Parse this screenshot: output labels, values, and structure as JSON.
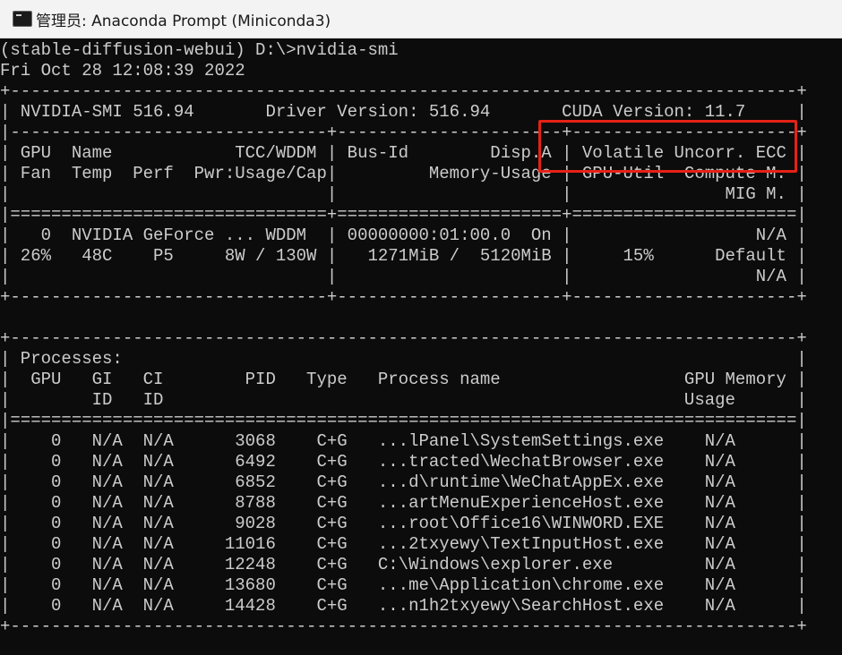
{
  "window": {
    "title": "管理员: Anaconda Prompt (Miniconda3)",
    "icon": "terminal-icon"
  },
  "terminal": {
    "lines": [
      "(stable-diffusion-webui) D:\\>nvidia-smi",
      "Fri Oct 28 12:08:39 2022",
      "+-----------------------------------------------------------------------------+",
      "| NVIDIA-SMI 516.94       Driver Version: 516.94       CUDA Version: 11.7     |",
      "|-------------------------------+----------------------+----------------------+",
      "| GPU  Name            TCC/WDDM | Bus-Id        Disp.A | Volatile Uncorr. ECC |",
      "| Fan  Temp  Perf  Pwr:Usage/Cap|         Memory-Usage | GPU-Util  Compute M. |",
      "|                               |                      |               MIG M. |",
      "|===============================+======================+======================|",
      "|   0  NVIDIA GeForce ... WDDM  | 00000000:01:00.0  On |                  N/A |",
      "| 26%   48C    P5     8W / 130W |   1271MiB /  5120MiB |     15%      Default |",
      "|                               |                      |                  N/A |",
      "+-------------------------------+----------------------+----------------------+",
      "",
      "+-----------------------------------------------------------------------------+",
      "| Processes:                                                                  |",
      "|  GPU   GI   CI        PID   Type   Process name                  GPU Memory |",
      "|        ID   ID                                                   Usage      |",
      "|=============================================================================|",
      "|    0   N/A  N/A      3068    C+G   ...lPanel\\SystemSettings.exe    N/A      |",
      "|    0   N/A  N/A      6492    C+G   ...tracted\\WechatBrowser.exe    N/A      |",
      "|    0   N/A  N/A      6852    C+G   ...d\\runtime\\WeChatAppEx.exe    N/A      |",
      "|    0   N/A  N/A      8788    C+G   ...artMenuExperienceHost.exe    N/A      |",
      "|    0   N/A  N/A      9028    C+G   ...root\\Office16\\WINWORD.EXE    N/A      |",
      "|    0   N/A  N/A     11016    C+G   ...2txyewy\\TextInputHost.exe    N/A      |",
      "|    0   N/A  N/A     12248    C+G   C:\\Windows\\explorer.exe         N/A      |",
      "|    0   N/A  N/A     13680    C+G   ...me\\Application\\chrome.exe    N/A      |",
      "|    0   N/A  N/A     14428    C+G   ...n1h2txyewy\\SearchHost.exe    N/A      |",
      "+-----------------------------------------------------------------------------+"
    ]
  },
  "colors": {
    "terminal_bg": "#0c0c0c",
    "terminal_fg": "#cccccc",
    "highlight_border": "#e62117",
    "titlebar_bg": "#f3f3f3"
  }
}
